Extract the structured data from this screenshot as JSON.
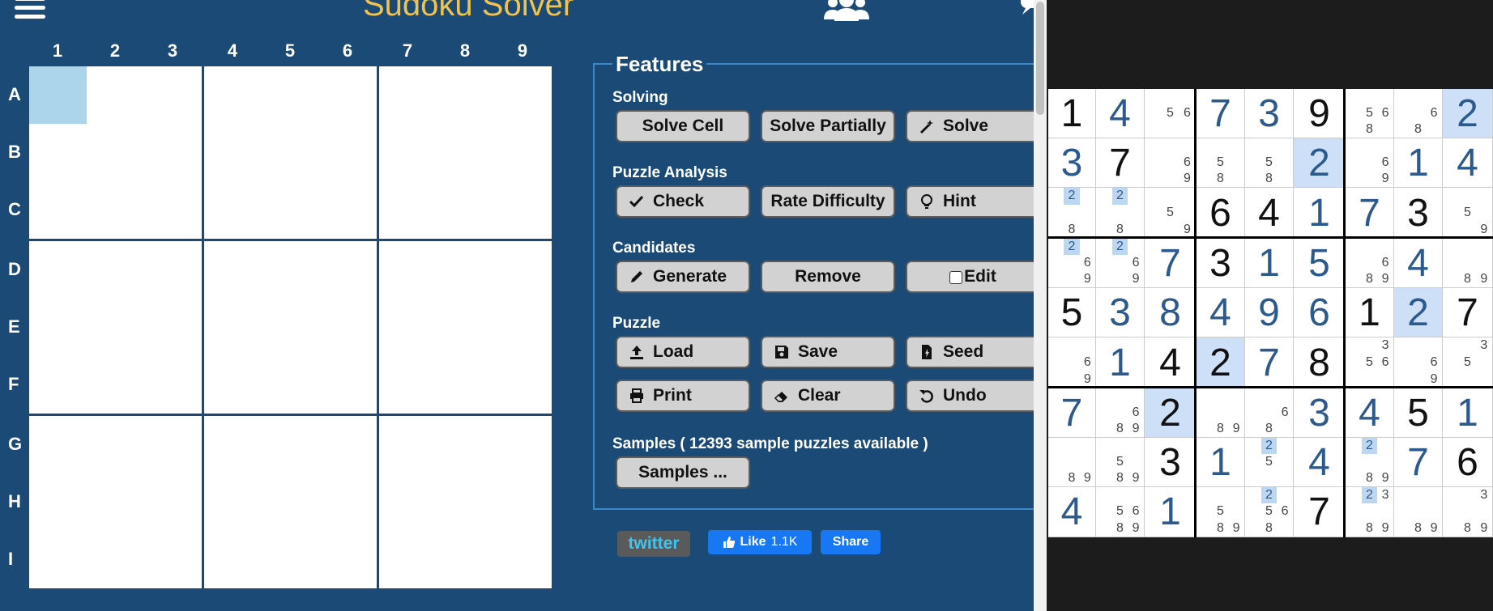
{
  "app": {
    "title": "Sudoku Solver"
  },
  "board": {
    "column_labels": [
      "1",
      "2",
      "3",
      "4",
      "5",
      "6",
      "7",
      "8",
      "9"
    ],
    "row_labels": [
      "A",
      "B",
      "C",
      "D",
      "E",
      "F",
      "G",
      "H",
      "I"
    ],
    "selected_cell": "A1"
  },
  "features": {
    "legend": "Features",
    "sections": [
      {
        "label": "Solving",
        "buttons": [
          {
            "label": "Solve Cell",
            "icon": ""
          },
          {
            "label": "Solve Partially",
            "icon": ""
          },
          {
            "label": "Solve",
            "icon": "magic-wand-icon"
          }
        ]
      },
      {
        "label": "Puzzle Analysis",
        "buttons": [
          {
            "label": "Check",
            "icon": "checkmark-icon"
          },
          {
            "label": "Rate Difficulty",
            "icon": ""
          },
          {
            "label": "Hint",
            "icon": "lightbulb-icon"
          }
        ]
      },
      {
        "label": "Candidates",
        "buttons": [
          {
            "label": "Generate",
            "icon": "pencil-icon"
          },
          {
            "label": "Remove",
            "icon": ""
          },
          {
            "label": "Edit",
            "icon": "checkbox-icon",
            "checked": false
          }
        ]
      },
      {
        "label": "Puzzle",
        "buttons": [
          {
            "label": "Load",
            "icon": "upload-icon"
          },
          {
            "label": "Save",
            "icon": "floppy-disk-icon"
          },
          {
            "label": "Seed",
            "icon": "seed-file-icon"
          },
          {
            "label": "Print",
            "icon": "printer-icon"
          },
          {
            "label": "Clear",
            "icon": "eraser-icon"
          },
          {
            "label": "Undo",
            "icon": "undo-icon"
          }
        ]
      },
      {
        "label": "Samples ( 12393 sample puzzles available )",
        "buttons": [
          {
            "label": "Samples ...",
            "icon": ""
          }
        ]
      }
    ]
  },
  "social": {
    "twitter_label": "twitter",
    "like_label": "Like",
    "like_count": "1.1K",
    "share_label": "Share"
  },
  "colors": {
    "background": "#1a4a75",
    "title": "#f2c24f",
    "selected_cell": "#acd4ea",
    "facebook": "#1877f2"
  },
  "solved_puzzle": {
    "rows": [
      [
        {
          "v": "1",
          "t": "given"
        },
        {
          "v": "4",
          "t": "solved"
        },
        {
          "c": [
            "5",
            "6"
          ]
        },
        {
          "v": "7",
          "t": "solved"
        },
        {
          "v": "3",
          "t": "solved"
        },
        {
          "v": "9",
          "t": "given"
        },
        {
          "c": [
            "5",
            "6",
            "8"
          ]
        },
        {
          "c": [
            "6",
            "8"
          ]
        },
        {
          "v": "2",
          "t": "solved",
          "hl": true
        }
      ],
      [
        {
          "v": "3",
          "t": "solved"
        },
        {
          "v": "7",
          "t": "given"
        },
        {
          "c": [
            "6",
            "9"
          ]
        },
        {
          "c": [
            "5",
            "8"
          ]
        },
        {
          "c": [
            "5",
            "8"
          ]
        },
        {
          "v": "2",
          "t": "solved",
          "hl": true
        },
        {
          "c": [
            "6",
            "9"
          ]
        },
        {
          "v": "1",
          "t": "solved"
        },
        {
          "v": "4",
          "t": "solved"
        }
      ],
      [
        {
          "c": [
            "2",
            "8"
          ],
          "hc": [
            "2"
          ]
        },
        {
          "c": [
            "2",
            "8"
          ],
          "hc": [
            "2"
          ]
        },
        {
          "c": [
            "5",
            "9"
          ]
        },
        {
          "v": "6",
          "t": "given"
        },
        {
          "v": "4",
          "t": "given"
        },
        {
          "v": "1",
          "t": "solved"
        },
        {
          "v": "7",
          "t": "solved"
        },
        {
          "v": "3",
          "t": "given"
        },
        {
          "c": [
            "5",
            "9"
          ]
        }
      ],
      [
        {
          "c": [
            "2",
            "6",
            "9"
          ],
          "hc": [
            "2"
          ]
        },
        {
          "c": [
            "2",
            "6",
            "9"
          ],
          "hc": [
            "2"
          ]
        },
        {
          "v": "7",
          "t": "solved"
        },
        {
          "v": "3",
          "t": "given"
        },
        {
          "v": "1",
          "t": "solved"
        },
        {
          "v": "5",
          "t": "solved"
        },
        {
          "c": [
            "6",
            "8",
            "9"
          ]
        },
        {
          "v": "4",
          "t": "solved"
        },
        {
          "c": [
            "8",
            "9"
          ]
        }
      ],
      [
        {
          "v": "5",
          "t": "given"
        },
        {
          "v": "3",
          "t": "solved"
        },
        {
          "v": "8",
          "t": "solved"
        },
        {
          "v": "4",
          "t": "solved"
        },
        {
          "v": "9",
          "t": "solved"
        },
        {
          "v": "6",
          "t": "solved"
        },
        {
          "v": "1",
          "t": "given"
        },
        {
          "v": "2",
          "t": "solved",
          "hl": true
        },
        {
          "v": "7",
          "t": "given"
        }
      ],
      [
        {
          "c": [
            "6",
            "9"
          ]
        },
        {
          "v": "1",
          "t": "solved"
        },
        {
          "v": "4",
          "t": "given"
        },
        {
          "v": "2",
          "t": "given",
          "hl": true
        },
        {
          "v": "7",
          "t": "solved"
        },
        {
          "v": "8",
          "t": "given"
        },
        {
          "c": [
            "3",
            "5",
            "6"
          ]
        },
        {
          "c": [
            "6",
            "9"
          ]
        },
        {
          "c": [
            "3",
            "5"
          ]
        }
      ],
      [
        {
          "v": "7",
          "t": "solved"
        },
        {
          "c": [
            "6",
            "8",
            "9"
          ]
        },
        {
          "v": "2",
          "t": "given",
          "hl": true
        },
        {
          "c": [
            "8",
            "9"
          ]
        },
        {
          "c": [
            "6",
            "8"
          ]
        },
        {
          "v": "3",
          "t": "solved"
        },
        {
          "v": "4",
          "t": "solved"
        },
        {
          "v": "5",
          "t": "given"
        },
        {
          "v": "1",
          "t": "solved"
        }
      ],
      [
        {
          "c": [
            "8",
            "9"
          ]
        },
        {
          "c": [
            "5",
            "8",
            "9"
          ]
        },
        {
          "v": "3",
          "t": "given"
        },
        {
          "v": "1",
          "t": "solved"
        },
        {
          "c": [
            "2",
            "5"
          ],
          "hc": [
            "2"
          ]
        },
        {
          "v": "4",
          "t": "solved"
        },
        {
          "c": [
            "2",
            "8",
            "9"
          ],
          "hc": [
            "2"
          ]
        },
        {
          "v": "7",
          "t": "solved"
        },
        {
          "v": "6",
          "t": "given"
        }
      ],
      [
        {
          "v": "4",
          "t": "solved"
        },
        {
          "c": [
            "5",
            "6",
            "8",
            "9"
          ]
        },
        {
          "v": "1",
          "t": "solved"
        },
        {
          "c": [
            "5",
            "8",
            "9"
          ]
        },
        {
          "c": [
            "2",
            "5",
            "6",
            "8"
          ],
          "hc": [
            "2"
          ]
        },
        {
          "v": "7",
          "t": "given"
        },
        {
          "c": [
            "2",
            "3",
            "8",
            "9"
          ],
          "hc": [
            "2"
          ]
        },
        {
          "c": [
            "8",
            "9"
          ]
        },
        {
          "c": [
            "3",
            "8",
            "9"
          ]
        }
      ]
    ]
  }
}
